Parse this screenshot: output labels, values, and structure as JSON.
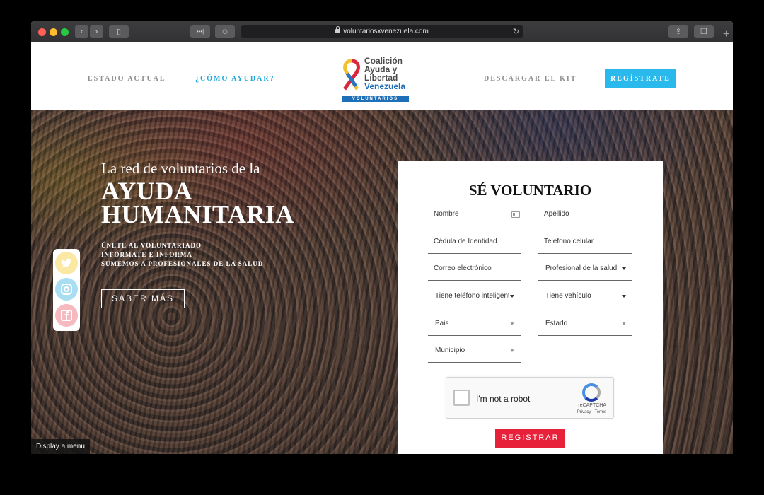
{
  "browser": {
    "url": "voluntariosxvenezuela.com",
    "reader_label": "•••|",
    "plus_label": "+"
  },
  "nav": {
    "links": [
      "ESTADO ACTUAL",
      "¿CÓMO AYUDAR?",
      "DESCARGAR EL KIT"
    ],
    "cta": "REGÍSTRATE",
    "logo": {
      "line1": "Coalición",
      "line2": "Ayuda y",
      "line3": "Libertad",
      "line4": "Venezuela",
      "bar": "VOLUNTARIOS"
    }
  },
  "hero": {
    "pretitle": "La red de voluntarios de la",
    "title_line1": "AYUDA",
    "title_line2": "HUMANITARIA",
    "taglines": [
      "ÚNETE AL VOLUNTARIADO",
      "INFÓRMATE E INFORMA",
      "SUMEMOS A PROFESIONALES DE LA SALUD"
    ],
    "button": "SABER MÁS"
  },
  "social": [
    "twitter-icon",
    "instagram-icon",
    "facebook-icon"
  ],
  "form": {
    "title": "SÉ VOLUNTARIO",
    "fields": {
      "nombre": "Nombre",
      "apellido": "Apellido",
      "cedula": "Cédula de Identidad",
      "telefono": "Teléfono celular",
      "correo": "Correo electrónico",
      "profesional": "Profesional de la salud",
      "smartphone": "Tiene teléfono inteligente",
      "vehiculo": "Tiene vehículo",
      "pais": "Pais",
      "estado": "Estado",
      "municipio": "Municipio"
    },
    "captcha": {
      "label": "I'm not a robot",
      "brand": "reCAPTCHA",
      "links": "Privacy - Terms"
    },
    "submit": "REGISTRAR"
  },
  "tooltip": "Display a menu",
  "colors": {
    "accent": "#29b9ec",
    "active_nav": "#1fa8d8",
    "submit": "#e8213b"
  }
}
